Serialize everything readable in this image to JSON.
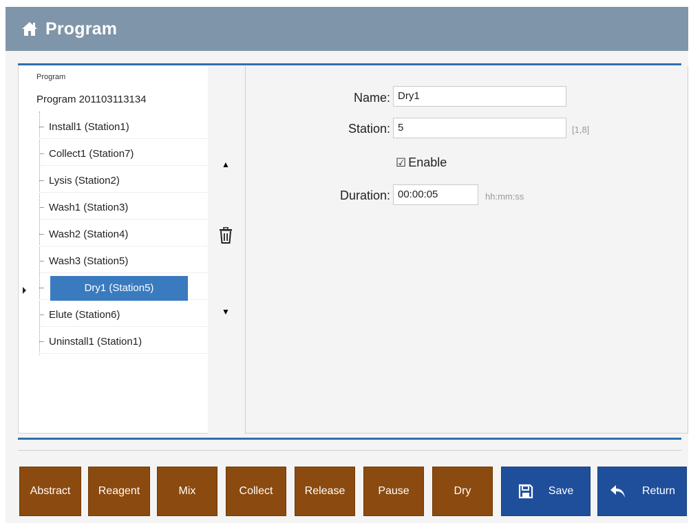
{
  "header": {
    "title": "Program",
    "icon": "home-icon"
  },
  "tree": {
    "caption": "Program",
    "root": "Program 201103113134",
    "items": [
      {
        "label": "Install1 (Station1)"
      },
      {
        "label": "Collect1 (Station7)"
      },
      {
        "label": "Lysis (Station2)"
      },
      {
        "label": "Wash1 (Station3)"
      },
      {
        "label": "Wash2 (Station4)"
      },
      {
        "label": "Wash3 (Station5)"
      },
      {
        "label": "Dry1 (Station5)",
        "selected": true
      },
      {
        "label": "Elute (Station6)"
      },
      {
        "label": "Uninstall1 (Station1)"
      }
    ]
  },
  "controls": {
    "up": "▲",
    "down": "▼",
    "delete_icon": "trash-icon"
  },
  "form": {
    "name_label": "Name:",
    "name_value": "Dry1",
    "station_label": "Station:",
    "station_value": "5",
    "station_range": "[1,8]",
    "enable_label": "Enable",
    "enable_checked": true,
    "enable_mark": "☑",
    "duration_label": "Duration:",
    "duration_value": "00:00:05",
    "duration_hint": "hh:mm:ss"
  },
  "toolbar": {
    "abstract": "Abstract",
    "reagent": "Reagent",
    "mix": "Mix",
    "collect": "Collect",
    "release": "Release",
    "pause": "Pause",
    "dry": "Dry",
    "save": "Save",
    "return": "Return"
  },
  "colors": {
    "titlebar": "#7f95a9",
    "accent_blue": "#2f6eb2",
    "selected": "#3a7bbf",
    "step_button": "#8b4a0f",
    "action_button": "#1f4f9b"
  }
}
